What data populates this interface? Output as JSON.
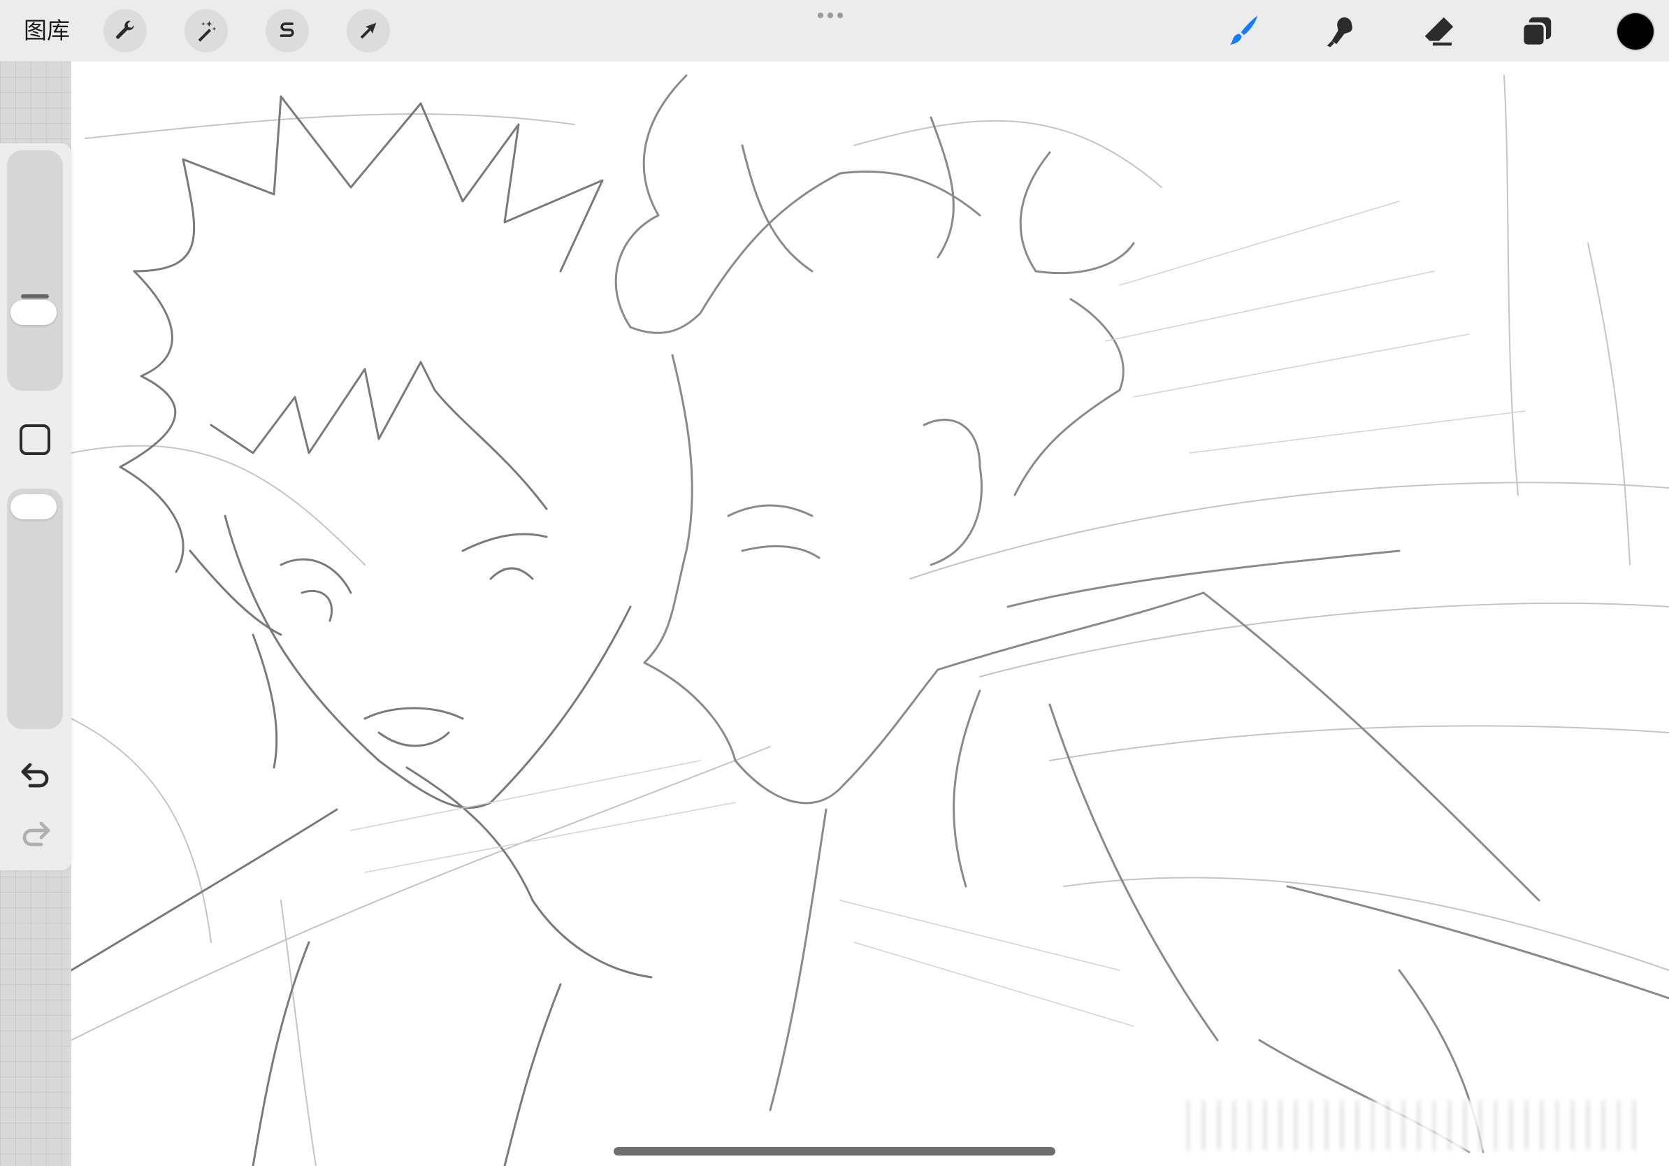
{
  "toolbar": {
    "gallery_label": "图库",
    "left_tools": [
      {
        "name": "actions",
        "icon": "wrench-icon"
      },
      {
        "name": "adjustments",
        "icon": "magic-wand-icon"
      },
      {
        "name": "selection",
        "icon": "selection-s-icon"
      },
      {
        "name": "transform",
        "icon": "arrow-cursor-icon"
      }
    ],
    "right_tools": [
      {
        "name": "brush",
        "icon": "brush-icon",
        "active": true
      },
      {
        "name": "smudge",
        "icon": "smudge-icon",
        "active": false
      },
      {
        "name": "eraser",
        "icon": "eraser-icon",
        "active": false
      },
      {
        "name": "layers",
        "icon": "layers-icon",
        "active": false
      }
    ],
    "current_color": "#000000",
    "accent_color": "#1a7cf5"
  },
  "sidebar": {
    "brush_size": 0.7,
    "opacity": 1.0,
    "undo_icon": "undo-icon",
    "redo_icon": "redo-icon"
  },
  "canvas": {
    "background": "#ffffff",
    "content": "pencil-sketch-artwork"
  }
}
